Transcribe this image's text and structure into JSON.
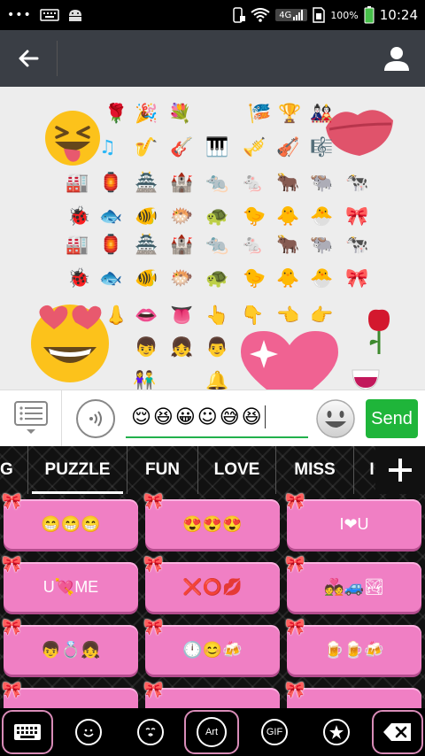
{
  "status_bar": {
    "network": "4G",
    "battery": "100%",
    "time": "10:24"
  },
  "input": {
    "message": "😌😆😀☺😅😆"
  },
  "send_label": "Send",
  "tabs": [
    "G",
    "PUZZLE",
    "FUN",
    "LOVE",
    "MISS",
    "I"
  ],
  "active_tab": "PUZZLE",
  "tiles": [
    "😁😁😁",
    "😍😍😍",
    "I❤U",
    "U💘ME",
    "❌⭕💋",
    "💑🚙🏞",
    "👦💍👧",
    "🕛😊🍻",
    "🍺🍺🍻"
  ],
  "toolbar": {
    "art_label": "Art",
    "gif_label": "GIF"
  },
  "colors": {
    "tile": "#f07fc4",
    "send": "#1fb53a",
    "appbar": "#3a3e45"
  },
  "icons": [
    "back-arrow-icon",
    "profile-icon",
    "menu-list-icon",
    "voice-icon",
    "emoji-smiley-icon",
    "keyboard-icon",
    "smile-icon",
    "kiss-face-icon",
    "art-icon",
    "gif-icon",
    "star-icon",
    "backspace-icon",
    "plus-icon"
  ]
}
